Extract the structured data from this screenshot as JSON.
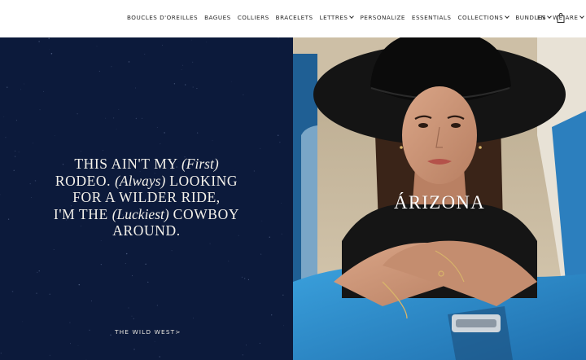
{
  "nav": {
    "items": [
      {
        "label": "BOUCLES D'OREILLES",
        "dropdown": false
      },
      {
        "label": "BAGUES",
        "dropdown": false
      },
      {
        "label": "COLLIERS",
        "dropdown": false
      },
      {
        "label": "BRACELETS",
        "dropdown": false
      },
      {
        "label": "LETTRES",
        "dropdown": true
      },
      {
        "label": "PERSONALIZE",
        "dropdown": false
      },
      {
        "label": "ESSENTIALS",
        "dropdown": false
      },
      {
        "label": "COLLECTIONS",
        "dropdown": true
      },
      {
        "label": "BUNDLES",
        "dropdown": false
      },
      {
        "label": "WE ARE",
        "dropdown": true
      }
    ],
    "language": "EN",
    "cart_icon": "shopping-bag-icon"
  },
  "hero_left": {
    "lines": [
      [
        {
          "t": "THIS AIN'T MY ",
          "i": false
        },
        {
          "t": "(First)",
          "i": true
        }
      ],
      [
        {
          "t": "RODEO. ",
          "i": false
        },
        {
          "t": "(Always)",
          "i": true
        },
        {
          "t": " LOOKING",
          "i": false
        }
      ],
      [
        {
          "t": "FOR A WILDER RIDE,",
          "i": false
        }
      ],
      [
        {
          "t": "I'M THE ",
          "i": false
        },
        {
          "t": "(Luckiest)",
          "i": true
        },
        {
          "t": " COWBOY",
          "i": false
        }
      ],
      [
        {
          "t": "AROUND.",
          "i": false
        }
      ]
    ],
    "cta": "THE WILD WEST>"
  },
  "hero_right": {
    "overlay_title": "ÁRIZONA"
  },
  "colors": {
    "navy": "#0c1a3b",
    "cream": "#f4f1ea",
    "car_blue": "#2f8fd0"
  }
}
